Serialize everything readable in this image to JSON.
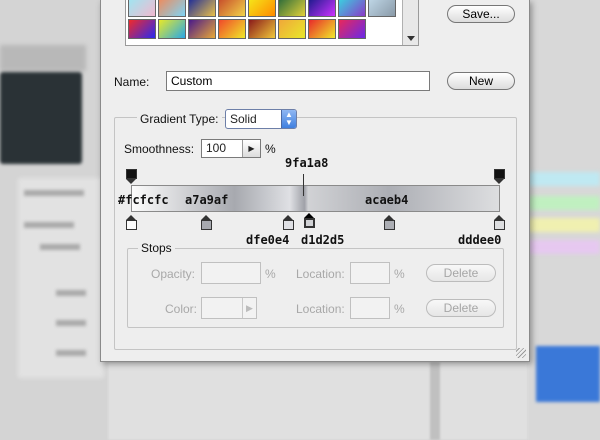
{
  "presets": {
    "swatch_colors": [
      [
        "#9ee6f2",
        "#f2b9cf"
      ],
      [
        "#f08a5a",
        "#7fd4f5"
      ],
      [
        "#1a2a9a",
        "#e9c04a"
      ],
      [
        "#c64a2a",
        "#f2d34a"
      ],
      [
        "#f5e81a",
        "#ff8a00"
      ],
      [
        "#2a6a3a",
        "#e3d13a"
      ],
      [
        "#1a1a8a",
        "#cc33ff"
      ],
      [
        "#38d4e0",
        "#8a3ac8"
      ],
      [
        "#c0d8e8",
        "#8a9aa8"
      ],
      [
        "#f02a2a",
        "#2a2af0"
      ],
      [
        "#e8e828",
        "#28a8e8"
      ],
      [
        "#4a1a8a",
        "#e8a838"
      ],
      [
        "#f04a2a",
        "#f0e82a"
      ],
      [
        "#8a1a1a",
        "#f0c83a"
      ],
      [
        "#f0a83a",
        "#e8e82a"
      ],
      [
        "#e82a2a",
        "#f0e82a"
      ],
      [
        "#e8285a",
        "#6a28e8"
      ]
    ]
  },
  "buttons": {
    "save": "Save...",
    "new": "New",
    "delete_opacity": "Delete",
    "delete_color": "Delete"
  },
  "name_row": {
    "label": "Name:",
    "value": "Custom"
  },
  "gradient_type": {
    "label": "Gradient Type:",
    "value": "Solid"
  },
  "smoothness": {
    "label": "Smoothness:",
    "value": "100",
    "unit": "%"
  },
  "gradient": {
    "stops": [
      {
        "color": "#fcfcfc",
        "position": 0.0
      },
      {
        "color": "#a7a9af",
        "position": 0.28
      },
      {
        "color": "#dfe0e4",
        "position": 0.43
      },
      {
        "color": "#9fa1a8",
        "position": 0.47
      },
      {
        "color": "#d1d2d5",
        "position": 0.48
      },
      {
        "color": "#acaeb4",
        "position": 0.7
      },
      {
        "color": "#dddee0",
        "position": 1.0
      }
    ],
    "midpoint_position": 0.47
  },
  "annotations": {
    "top_marker": "9fa1a8",
    "left": "#fcfcfc",
    "stop2": "a7a9af",
    "stop4": "acaeb4",
    "bottom1": "dfe0e4",
    "bottom2": "d1d2d5",
    "bottom3": "dddee0"
  },
  "stops_panel": {
    "title": "Stops",
    "opacity_label": "Opacity:",
    "opacity_unit": "%",
    "location_label": "Location:",
    "location_unit": "%",
    "color_label": "Color:",
    "location2_label": "Location:",
    "location2_unit": "%"
  },
  "colors": {
    "select_accent": "#3f7fdf",
    "dialog_bg": "#eeeeee"
  }
}
